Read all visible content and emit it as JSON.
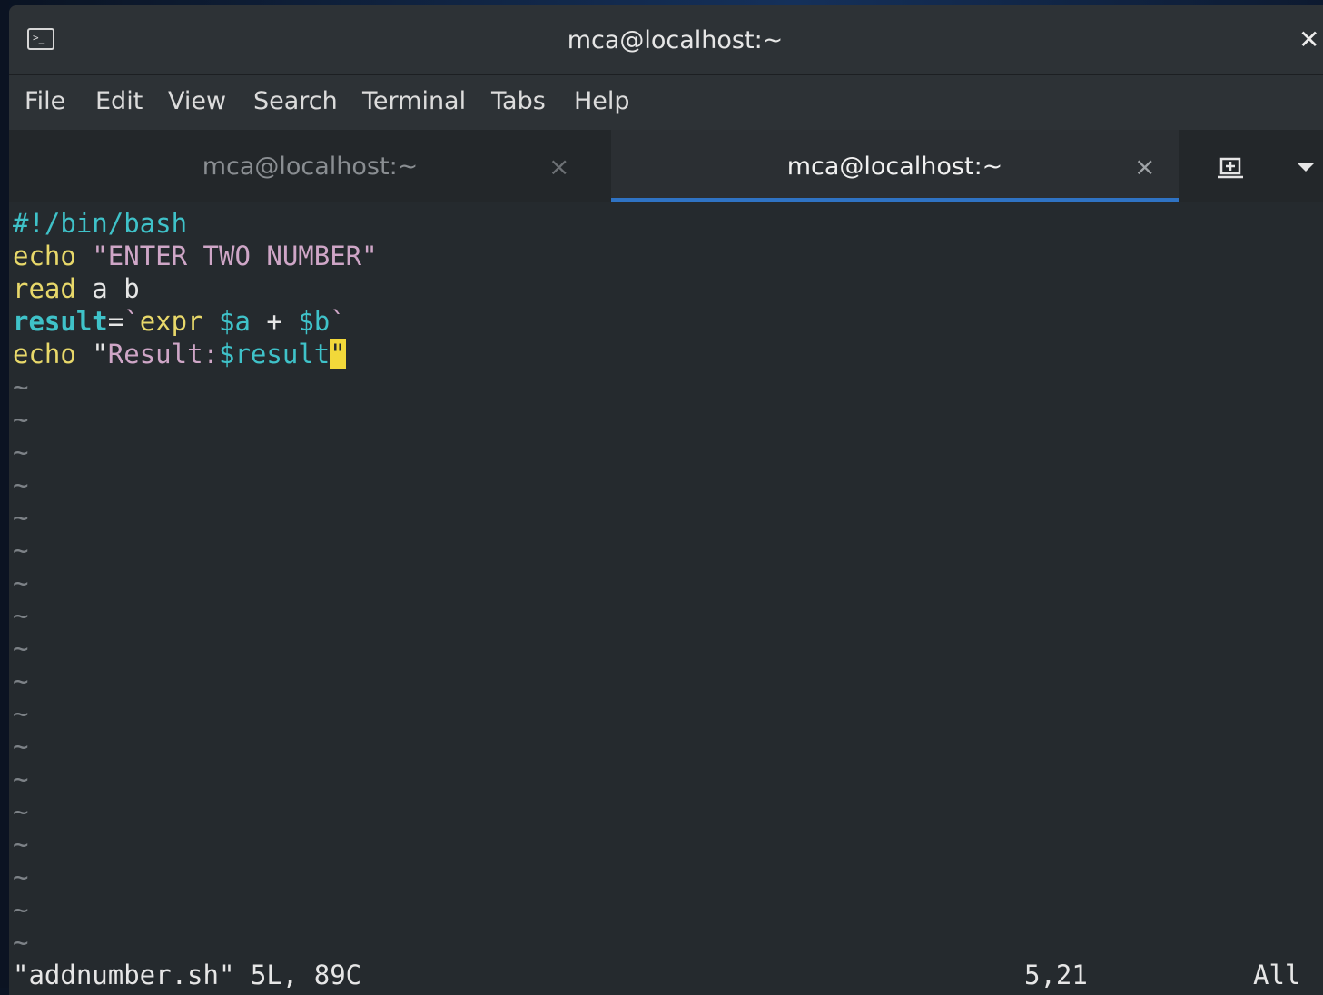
{
  "window": {
    "title": "mca@localhost:~",
    "app_icon_glyph": ">_"
  },
  "menu": {
    "items": [
      "File",
      "Edit",
      "View",
      "Search",
      "Terminal",
      "Tabs",
      "Help"
    ]
  },
  "tabs": [
    {
      "label": "mca@localhost:~",
      "active": false,
      "close": "×"
    },
    {
      "label": "mca@localhost:~",
      "active": true,
      "close": "×"
    }
  ],
  "tabbar_buttons": {
    "new_tab_icon": "new-tab-icon",
    "dropdown_icon": "chevron-down-icon"
  },
  "editor": {
    "lines": {
      "l1": {
        "shebang": "#!/bin/bash"
      },
      "l2": {
        "kw": "echo",
        "str": "\"ENTER TWO NUMBER\""
      },
      "l3": {
        "kw": "read",
        "rest": " a b"
      },
      "l4": {
        "ident": "result",
        "eq": "=",
        "bt1": "`",
        "cmd": "expr",
        "va": "$a",
        "plus": " + ",
        "vb": "$b",
        "bt2": "`"
      },
      "l5": {
        "kw": "echo",
        "q1": "\"",
        "text": "Result:",
        "var": "$result",
        "cursor_char": "\""
      }
    },
    "tilde": "~",
    "tilde_count": 18,
    "status": {
      "file_info": "\"addnumber.sh\" 5L, 89C",
      "position": "5,21",
      "scroll": "All"
    }
  },
  "colors": {
    "background": "#252a2e",
    "accent": "#2f73c4",
    "keyword": "#e8d86a",
    "string": "#cfa6c7",
    "identifier": "#3fc2c9",
    "cursor": "#f2d83a"
  }
}
